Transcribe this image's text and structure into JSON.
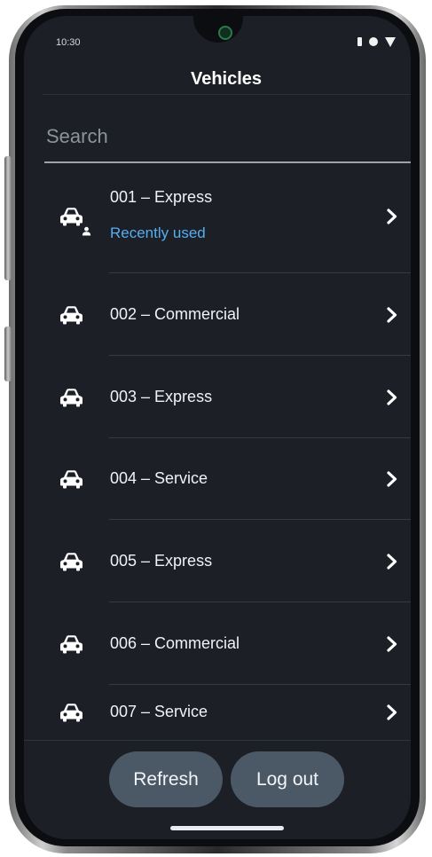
{
  "status_bar": {
    "time": "10:30"
  },
  "header": {
    "title": "Vehicles"
  },
  "search": {
    "placeholder": "Search",
    "value": ""
  },
  "vehicles": [
    {
      "name": "001 – Express",
      "subtitle": "Recently used"
    },
    {
      "name": "002 – Commercial"
    },
    {
      "name": "003 – Express"
    },
    {
      "name": "004 – Service"
    },
    {
      "name": "005 – Express"
    },
    {
      "name": "006 – Commercial"
    },
    {
      "name": "007 – Service"
    }
  ],
  "actions": {
    "refresh_label": "Refresh",
    "logout_label": "Log out"
  },
  "colors": {
    "background": "#1c1f26",
    "accent": "#55aef0",
    "button": "#4b5866",
    "text": "#f0f2f5"
  },
  "icons": {
    "vehicle": "car-icon",
    "recent_driver": "person-icon",
    "row_action": "chevron-right-icon"
  }
}
